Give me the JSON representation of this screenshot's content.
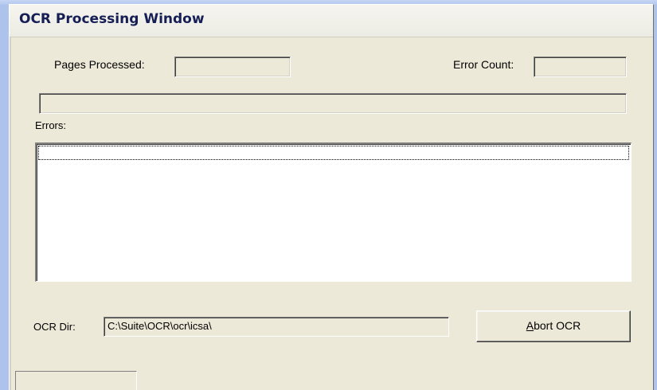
{
  "window": {
    "title": "OCR Processing Window"
  },
  "counters": {
    "pages_processed_label": "Pages Processed:",
    "pages_processed_value": "",
    "error_count_label": "Error Count:",
    "error_count_value": ""
  },
  "progress": {
    "value": 0
  },
  "errors": {
    "label": "Errors:",
    "items": []
  },
  "ocr_dir": {
    "label": "OCR Dir:",
    "value": "C:\\Suite\\OCR\\ocr\\icsa\\"
  },
  "abort_button": {
    "mnemonic": "A",
    "rest": "bort OCR"
  },
  "statusbar": {
    "text": ""
  }
}
